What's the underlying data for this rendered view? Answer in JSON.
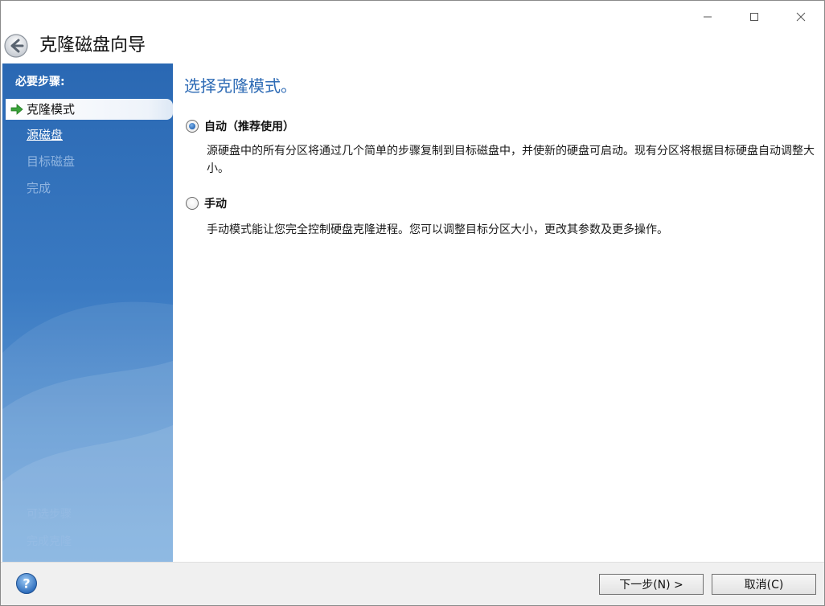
{
  "window": {
    "title": "克隆磁盘向导"
  },
  "sidebar": {
    "header": "必要步骤:",
    "steps": [
      {
        "label": "克隆模式",
        "state": "active"
      },
      {
        "label": "源磁盘",
        "state": "link"
      },
      {
        "label": "目标磁盘",
        "state": "disabled"
      },
      {
        "label": "完成",
        "state": "disabled"
      }
    ],
    "extra_header": "可选步骤",
    "extra_item": "完成克隆"
  },
  "content": {
    "heading": "选择克隆模式。",
    "options": [
      {
        "label": "自动（推荐使用）",
        "checked": true,
        "description": "源硬盘中的所有分区将通过几个简单的步骤复制到目标磁盘中，并使新的硬盘可启动。现有分区将根据目标硬盘自动调整大小。"
      },
      {
        "label": "手动",
        "checked": false,
        "description": "手动模式能让您完全控制硬盘克隆进程。您可以调整目标分区大小，更改其参数及更多操作。"
      }
    ]
  },
  "footer": {
    "next_label": "下一步(N) >",
    "cancel_label": "取消(C)"
  },
  "icons": {
    "back": "back-arrow-icon",
    "help": "help-icon",
    "step_arrow": "green-arrow-icon"
  },
  "colors": {
    "accent": "#2e6bb5",
    "sidebar": "#2a68b3"
  }
}
